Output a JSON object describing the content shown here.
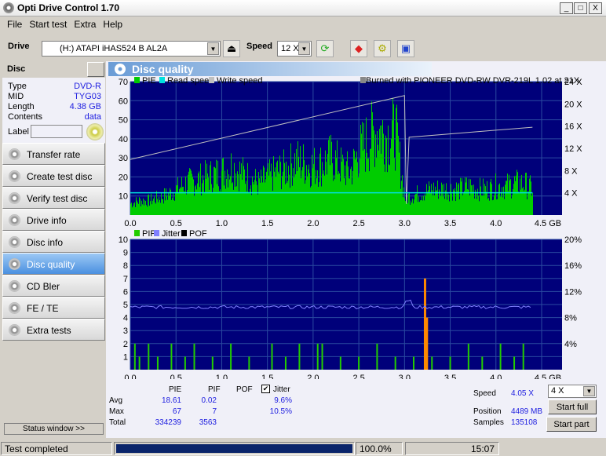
{
  "window": {
    "title": "Opti Drive Control 1.70",
    "min": "_",
    "max": "□",
    "close": "X"
  },
  "menu": [
    "File",
    "Start test",
    "Extra",
    "Help"
  ],
  "toolbar": {
    "drive_label": "Drive",
    "drive_value": "(H:)   ATAPI iHAS524   B AL2A",
    "speed_label": "Speed",
    "speed_value": "12 X"
  },
  "disc": {
    "header": "Disc",
    "rows": [
      {
        "k": "Type",
        "v": "DVD-R"
      },
      {
        "k": "MID",
        "v": "TYG03"
      },
      {
        "k": "Length",
        "v": "4.38 GB"
      },
      {
        "k": "Contents",
        "v": "data"
      }
    ],
    "label_label": "Label",
    "label_value": ""
  },
  "nav": [
    {
      "label": "Transfer rate"
    },
    {
      "label": "Create test disc"
    },
    {
      "label": "Verify test disc"
    },
    {
      "label": "Drive info"
    },
    {
      "label": "Disc info"
    },
    {
      "label": "Disc quality",
      "active": true
    },
    {
      "label": "CD Bler"
    },
    {
      "label": "FE / TE"
    },
    {
      "label": "Extra tests"
    }
  ],
  "status_window": "Status window >>",
  "panel_title": "Disc quality",
  "colors": {
    "pie": "#00cc00",
    "read": "#00e0e0",
    "write": "#c0c0c0",
    "pif": "#22cc00",
    "jitter": "#8080ff",
    "pof": "#000000",
    "plot_bg": "#00007a",
    "spike": "#ff8800"
  },
  "chart_data": [
    {
      "type": "bar",
      "legend": [
        "PIE",
        "Read speed",
        "Write speed"
      ],
      "note": "Burned with PIONEER DVD-RW  DVR-219L 1.02 at 21X",
      "xlabel": "GB",
      "x_ticks": [
        "0.0",
        "0.5",
        "1.0",
        "1.5",
        "2.0",
        "2.5",
        "3.0",
        "3.5",
        "4.0",
        "4.5 GB"
      ],
      "xlim": [
        0,
        4.5
      ],
      "y_ticks": [
        "10",
        "20",
        "30",
        "40",
        "50",
        "60",
        "70"
      ],
      "ylim": [
        0,
        70
      ],
      "y2_ticks": [
        "4 X",
        "8 X",
        "12 X",
        "16 X",
        "20 X",
        "24 X"
      ],
      "y2lim": [
        0,
        24
      ],
      "pie_x_step": 0.1,
      "pie": [
        8,
        10,
        10,
        12,
        14,
        18,
        22,
        24,
        26,
        28,
        30,
        34,
        30,
        26,
        22,
        26,
        30,
        32,
        38,
        36,
        34,
        36,
        40,
        34,
        30,
        44,
        52,
        60,
        56,
        58,
        12,
        14,
        16,
        18,
        18,
        18,
        18,
        20,
        18,
        18,
        20,
        20,
        22,
        22,
        18
      ],
      "write_speed": [
        [
          0,
          10
        ],
        [
          3.0,
          21.5
        ],
        [
          3.02,
          2
        ],
        [
          3.05,
          14
        ],
        [
          4.4,
          15.8
        ]
      ],
      "read_speed": [
        [
          0,
          4
        ],
        [
          4.4,
          4
        ]
      ]
    },
    {
      "type": "bar",
      "legend": [
        "PIF",
        "Jitter",
        "POF"
      ],
      "x_ticks": [
        "0.0",
        "0.5",
        "1.0",
        "1.5",
        "2.0",
        "2.5",
        "3.0",
        "3.5",
        "4.0",
        "4.5 GB"
      ],
      "xlim": [
        0,
        4.5
      ],
      "y_ticks": [
        "1",
        "2",
        "3",
        "4",
        "5",
        "6",
        "7",
        "8",
        "9",
        "10"
      ],
      "ylim": [
        0,
        10
      ],
      "y2_ticks": [
        "4%",
        "8%",
        "12%",
        "16%",
        "20%"
      ],
      "y2lim": [
        0,
        20
      ],
      "jitter_avg": 9.6,
      "pif": [
        [
          0.05,
          2
        ],
        [
          0.1,
          1
        ],
        [
          0.2,
          2
        ],
        [
          0.3,
          1
        ],
        [
          0.45,
          2
        ],
        [
          0.6,
          1
        ],
        [
          0.7,
          2
        ],
        [
          0.9,
          1
        ],
        [
          1.1,
          2
        ],
        [
          1.3,
          1
        ],
        [
          1.55,
          2
        ],
        [
          1.7,
          1
        ],
        [
          1.85,
          2
        ],
        [
          2.05,
          2
        ],
        [
          2.1,
          2
        ],
        [
          2.3,
          1
        ],
        [
          2.5,
          1
        ],
        [
          2.7,
          2
        ],
        [
          2.9,
          1
        ],
        [
          3.1,
          1
        ],
        [
          3.22,
          7
        ],
        [
          3.24,
          4
        ],
        [
          3.3,
          1
        ],
        [
          3.5,
          1
        ],
        [
          3.7,
          2
        ],
        [
          3.85,
          1
        ],
        [
          4.05,
          2
        ],
        [
          4.2,
          1
        ],
        [
          4.3,
          2
        ]
      ]
    }
  ],
  "stats": {
    "headers": [
      "PIE",
      "PIF",
      "POF"
    ],
    "jitter_label": "Jitter",
    "jitter_checked": true,
    "rows": [
      {
        "k": "Avg",
        "pie": "18.61",
        "pif": "0.02",
        "jit": "9.6%"
      },
      {
        "k": "Max",
        "pie": "67",
        "pif": "7",
        "jit": "10.5%"
      },
      {
        "k": "Total",
        "pie": "334239",
        "pif": "3563",
        "jit": ""
      }
    ]
  },
  "run": {
    "speed_label": "Speed",
    "speed_value": "4.05 X",
    "speed_select": "4 X",
    "position_label": "Position",
    "position_value": "4489 MB",
    "samples_label": "Samples",
    "samples_value": "135108",
    "start_full": "Start full",
    "start_part": "Start part"
  },
  "statusbar": {
    "text": "Test completed",
    "progress": 100,
    "progress_text": "100.0%",
    "time": "15:07"
  }
}
